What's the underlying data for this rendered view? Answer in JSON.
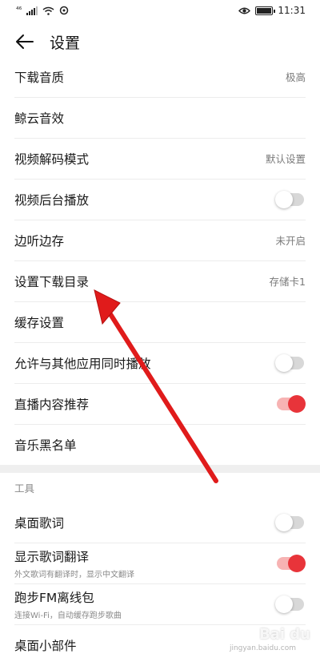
{
  "status_bar": {
    "signal_text": "⁴⁶",
    "time": "11:31",
    "icons": [
      "signal-icon",
      "wifi-icon",
      "sync-icon",
      "eye-icon",
      "battery-icon"
    ]
  },
  "header": {
    "title": "设置"
  },
  "settings": [
    {
      "label": "下载音质",
      "value": "极高"
    },
    {
      "label": "鲸云音效"
    },
    {
      "label": "视频解码模式",
      "value": "默认设置"
    },
    {
      "label": "视频后台播放",
      "toggle": false
    },
    {
      "label": "边听边存",
      "value": "未开启"
    },
    {
      "label": "设置下载目录",
      "value": "存储卡1"
    },
    {
      "label": "缓存设置"
    },
    {
      "label": "允许与其他应用同时播放",
      "toggle": false
    },
    {
      "label": "直播内容推荐",
      "toggle": true
    },
    {
      "label": "音乐黑名单"
    }
  ],
  "tools": {
    "header": "工具",
    "items": [
      {
        "label": "桌面歌词",
        "toggle": false
      },
      {
        "label": "显示歌词翻译",
        "subtitle": "外文歌词有翻译时，显示中文翻译",
        "toggle": true
      },
      {
        "label": "跑步FM离线包",
        "subtitle": "连接Wi-Fi，自动缓存跑步歌曲",
        "toggle": false
      },
      {
        "label": "桌面小部件"
      }
    ]
  },
  "watermark": {
    "text": "Bai du",
    "sub": "jingyan.baidu.com"
  },
  "colors": {
    "accent": "#e8343a",
    "annotation_arrow": "#e01b1b"
  }
}
